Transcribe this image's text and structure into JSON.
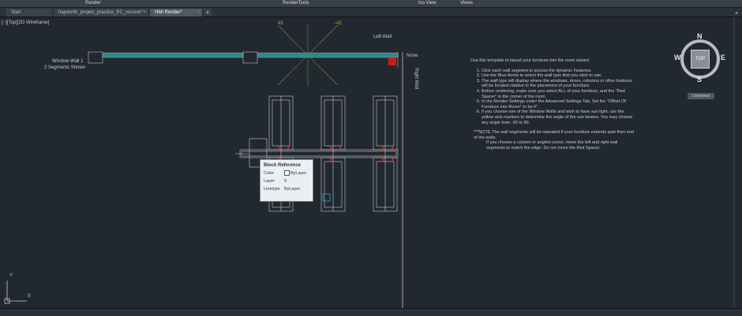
{
  "ribbon": {
    "render": "Render",
    "render_tools": "RenderTools",
    "iso_view": "Iso View",
    "views": "Views"
  },
  "tabs": [
    {
      "label": "Start"
    },
    {
      "label": "hayworth_project_practice_EC_recover*"
    },
    {
      "label": "HMI Render*"
    }
  ],
  "tab_plus": "+",
  "viewport_label": "[−][Top][2D Wireframe]",
  "window_wall": {
    "line1": "Window Wall 1",
    "line2": "2 Segments Shown"
  },
  "left_wall": "Left Wall",
  "angle_left": "45",
  "angle_right": "-45",
  "right_wall_none": "None",
  "right_wall": "Right Wall",
  "notes": {
    "intro": "Use this template to layout your furniture into the room wizard.",
    "steps": [
      "Click each wall segment to access the dynamic Features.",
      "Use the Blue Arrow to select the wall type that you wish to use.",
      "The wall type will display where the windows, doors, columns or other features will be located relative to the placement of your furniture.",
      "Before rendering, make sure you select ALL of your furniture, and the \"Red Spacer\" in the corner of the room.",
      "In the Render Settings under the Advanced Settings Tab, Set the \"Offset Of Furniture Into Room\" to be 0\".",
      "If you choose one of the Window Walls and wish to have sun light, use the yellow axis markers to determine the angle of the sun beams. You may choose any angle from -90 to 90."
    ],
    "note_lines": [
      "***NOTE     The wall segments will be repeated if your furniture extends past then end of the walls.",
      "If you choose a column or angled corner, move the left and right wall segments to match the edge.  Do not move the Red Spacer."
    ]
  },
  "popup": {
    "title": "Block Reference",
    "rows": [
      {
        "key": "Color",
        "value": "ByLayer"
      },
      {
        "key": "Layer",
        "value": "0"
      },
      {
        "key": "Linetype",
        "value": "ByLayer"
      }
    ]
  },
  "compass": {
    "n": "N",
    "s": "S",
    "e": "E",
    "w": "W",
    "top": "TOP"
  },
  "unnamed": "Unnamed",
  "ucs": {
    "x": "X",
    "y": "Y"
  },
  "close_glyph": "×",
  "colors": {
    "background": "#212830",
    "wall": "#2f8a8a",
    "spacer": "#d01818",
    "axis": "#8a9a3a"
  }
}
